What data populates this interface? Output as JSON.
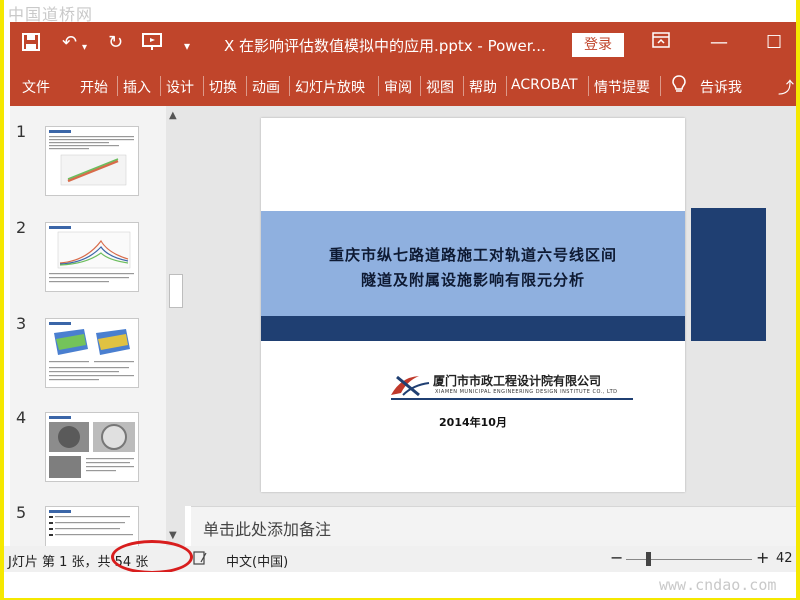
{
  "watermark": {
    "top": "中国道桥网",
    "bottom": "www.cndao.com"
  },
  "titlebar": {
    "save_icon": "save-icon",
    "undo_icon": "undo-icon",
    "redo_icon": "redo-icon",
    "present_icon": "present-icon",
    "customize_icon": "customize-icon",
    "title": "X 在影响评估数值模拟中的应用.pptx  -  Power...",
    "login": "登录"
  },
  "ribbon": {
    "tabs": [
      "文件",
      "开始",
      "插入",
      "设计",
      "切换",
      "动画",
      "幻灯片放映",
      "审阅",
      "视图",
      "帮助",
      "ACROBAT",
      "情节提要"
    ],
    "tell_me": "告诉我",
    "lightbulb_icon": "lightbulb-icon",
    "share_icon": "share-icon"
  },
  "thumbnails": {
    "numbers": [
      "1",
      "2",
      "3",
      "4",
      "5"
    ],
    "selected": "1"
  },
  "slide": {
    "title_line1": "重庆市纵七路道路施工对轨道六号线区间",
    "title_line2": "隧道及附属设施影响有限元分析",
    "company_cn": "厦门市市政工程设计院有限公司",
    "company_en": "XIAMEN MUNICIPAL ENGINEERING DESIGN INSTITUTE CO., LTD",
    "date": "2014年10月"
  },
  "notes": {
    "placeholder": "单击此处添加备注"
  },
  "statusbar": {
    "slide_count": "J灯片 第 1 张，共 54 张",
    "language": "中文(中国)",
    "zoom": "42"
  },
  "colors": {
    "accent": "#c0452b",
    "banner_light": "#8fb0df",
    "banner_dark": "#1f3f72",
    "annotation": "#d81d1d"
  }
}
